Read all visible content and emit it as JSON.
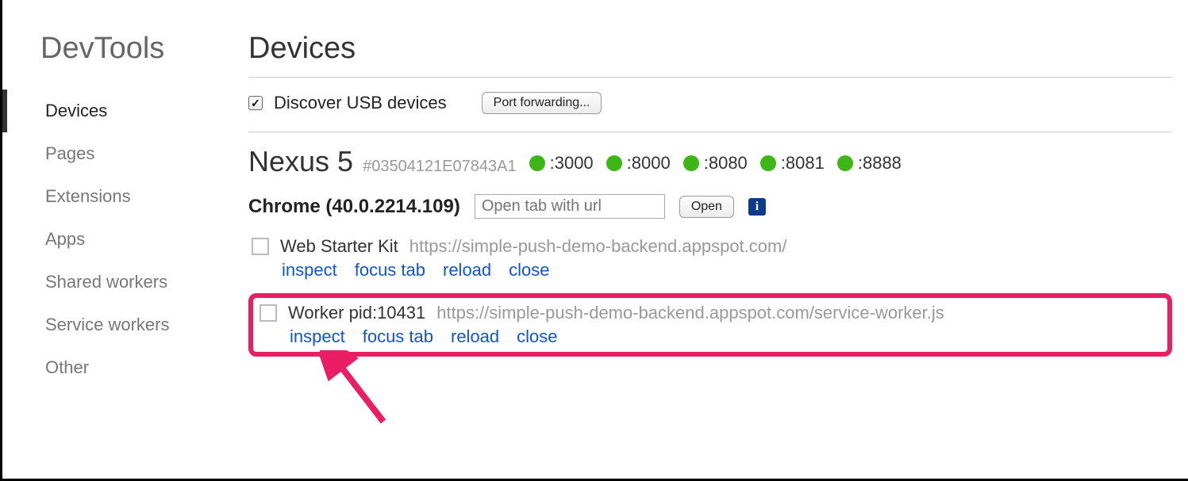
{
  "app_title": "DevTools",
  "sidebar": {
    "items": [
      {
        "label": "Devices",
        "active": true
      },
      {
        "label": "Pages",
        "active": false
      },
      {
        "label": "Extensions",
        "active": false
      },
      {
        "label": "Apps",
        "active": false
      },
      {
        "label": "Shared workers",
        "active": false
      },
      {
        "label": "Service workers",
        "active": false
      },
      {
        "label": "Other",
        "active": false
      }
    ]
  },
  "page_title": "Devices",
  "discover": {
    "label": "Discover USB devices",
    "checked": true
  },
  "port_forwarding_button": "Port forwarding...",
  "device": {
    "name": "Nexus 5",
    "id": "#03504121E07843A1",
    "ports": [
      ":3000",
      ":8000",
      ":8080",
      ":8081",
      ":8888"
    ]
  },
  "browser": {
    "label": "Chrome (40.0.2214.109)",
    "url_placeholder": "Open tab with url",
    "open_label": "Open"
  },
  "targets": [
    {
      "title": "Web Starter Kit",
      "url": "https://simple-push-demo-backend.appspot.com/",
      "highlighted": false
    },
    {
      "title": "Worker pid:10431",
      "url": "https://simple-push-demo-backend.appspot.com/service-worker.js",
      "highlighted": true
    }
  ],
  "actions": {
    "inspect": "inspect",
    "focus_tab": "focus tab",
    "reload": "reload",
    "close": "close"
  }
}
